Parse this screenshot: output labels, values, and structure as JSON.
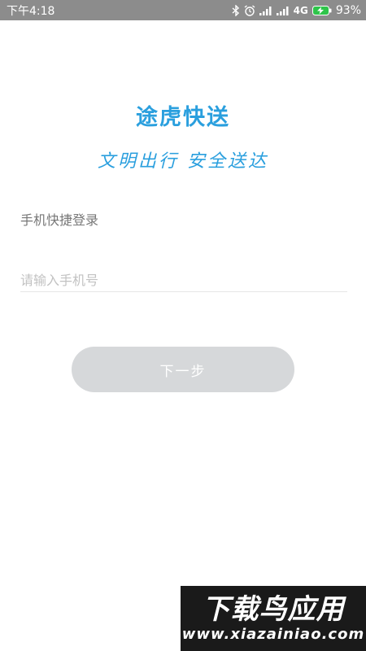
{
  "status_bar": {
    "time": "下午4:18",
    "network": "4G",
    "battery": "93%",
    "icons": [
      "bluetooth-icon",
      "alarm-icon",
      "signal-icon",
      "signal-icon",
      "battery-charging-icon"
    ]
  },
  "app": {
    "title": "途虎快送",
    "slogan": "文明出行 安全送达"
  },
  "login": {
    "heading": "手机快捷登录",
    "phone_placeholder": "请输入手机号",
    "phone_value": "",
    "next_label": "下一步"
  },
  "watermark": {
    "title": "下载鸟应用",
    "url": "www.xiazainiao.com"
  },
  "colors": {
    "accent": "#2a9fde",
    "status_bar": "#8c8c8c",
    "button_disabled": "#d6d8da",
    "battery_green": "#2ec44a"
  }
}
